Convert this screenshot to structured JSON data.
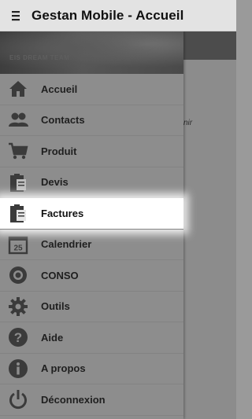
{
  "appbar": {
    "title": "Gestan Mobile - Accueil",
    "menu_icon": "hamburger-icon"
  },
  "drawer": {
    "header_text": "EIS DREAM TEAM",
    "items": [
      {
        "label": "Accueil",
        "icon": "home-icon",
        "active": false
      },
      {
        "label": "Contacts",
        "icon": "contacts-icon",
        "active": false
      },
      {
        "label": "Produit",
        "icon": "cart-icon",
        "active": false
      },
      {
        "label": "Devis",
        "icon": "clipboard-icon",
        "active": false
      },
      {
        "label": "Factures",
        "icon": "clipboard-icon",
        "active": true
      },
      {
        "label": "Calendrier",
        "icon": "calendar-icon",
        "active": false,
        "badge": "25"
      },
      {
        "label": "CONSO",
        "icon": "gauge-icon",
        "active": false
      },
      {
        "label": "Outils",
        "icon": "gear-icon",
        "active": false
      },
      {
        "label": "Aide",
        "icon": "help-icon",
        "active": false
      },
      {
        "label": "A propos",
        "icon": "info-icon",
        "active": false
      },
      {
        "label": "Déconnexion",
        "icon": "power-icon",
        "active": false
      }
    ]
  },
  "background_page": {
    "snippet": "nir"
  },
  "colors": {
    "appbar": "#e3e3e3",
    "drawer": "#8d8d8d",
    "icon": "#3b3b3b",
    "active_item": "#ffffff"
  }
}
